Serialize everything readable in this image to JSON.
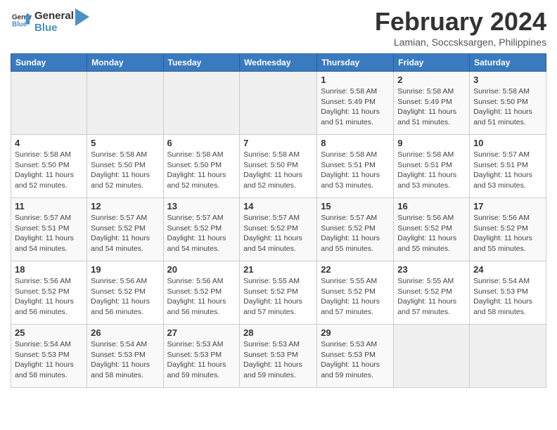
{
  "header": {
    "logo_line1": "General",
    "logo_line2": "Blue",
    "title": "February 2024",
    "subtitle": "Lamian, Soccsksargen, Philippines"
  },
  "weekdays": [
    "Sunday",
    "Monday",
    "Tuesday",
    "Wednesday",
    "Thursday",
    "Friday",
    "Saturday"
  ],
  "weeks": [
    [
      {
        "day": "",
        "info": ""
      },
      {
        "day": "",
        "info": ""
      },
      {
        "day": "",
        "info": ""
      },
      {
        "day": "",
        "info": ""
      },
      {
        "day": "1",
        "info": "Sunrise: 5:58 AM\nSunset: 5:49 PM\nDaylight: 11 hours\nand 51 minutes."
      },
      {
        "day": "2",
        "info": "Sunrise: 5:58 AM\nSunset: 5:49 PM\nDaylight: 11 hours\nand 51 minutes."
      },
      {
        "day": "3",
        "info": "Sunrise: 5:58 AM\nSunset: 5:50 PM\nDaylight: 11 hours\nand 51 minutes."
      }
    ],
    [
      {
        "day": "4",
        "info": "Sunrise: 5:58 AM\nSunset: 5:50 PM\nDaylight: 11 hours\nand 52 minutes."
      },
      {
        "day": "5",
        "info": "Sunrise: 5:58 AM\nSunset: 5:50 PM\nDaylight: 11 hours\nand 52 minutes."
      },
      {
        "day": "6",
        "info": "Sunrise: 5:58 AM\nSunset: 5:50 PM\nDaylight: 11 hours\nand 52 minutes."
      },
      {
        "day": "7",
        "info": "Sunrise: 5:58 AM\nSunset: 5:50 PM\nDaylight: 11 hours\nand 52 minutes."
      },
      {
        "day": "8",
        "info": "Sunrise: 5:58 AM\nSunset: 5:51 PM\nDaylight: 11 hours\nand 53 minutes."
      },
      {
        "day": "9",
        "info": "Sunrise: 5:58 AM\nSunset: 5:51 PM\nDaylight: 11 hours\nand 53 minutes."
      },
      {
        "day": "10",
        "info": "Sunrise: 5:57 AM\nSunset: 5:51 PM\nDaylight: 11 hours\nand 53 minutes."
      }
    ],
    [
      {
        "day": "11",
        "info": "Sunrise: 5:57 AM\nSunset: 5:51 PM\nDaylight: 11 hours\nand 54 minutes."
      },
      {
        "day": "12",
        "info": "Sunrise: 5:57 AM\nSunset: 5:52 PM\nDaylight: 11 hours\nand 54 minutes."
      },
      {
        "day": "13",
        "info": "Sunrise: 5:57 AM\nSunset: 5:52 PM\nDaylight: 11 hours\nand 54 minutes."
      },
      {
        "day": "14",
        "info": "Sunrise: 5:57 AM\nSunset: 5:52 PM\nDaylight: 11 hours\nand 54 minutes."
      },
      {
        "day": "15",
        "info": "Sunrise: 5:57 AM\nSunset: 5:52 PM\nDaylight: 11 hours\nand 55 minutes."
      },
      {
        "day": "16",
        "info": "Sunrise: 5:56 AM\nSunset: 5:52 PM\nDaylight: 11 hours\nand 55 minutes."
      },
      {
        "day": "17",
        "info": "Sunrise: 5:56 AM\nSunset: 5:52 PM\nDaylight: 11 hours\nand 55 minutes."
      }
    ],
    [
      {
        "day": "18",
        "info": "Sunrise: 5:56 AM\nSunset: 5:52 PM\nDaylight: 11 hours\nand 56 minutes."
      },
      {
        "day": "19",
        "info": "Sunrise: 5:56 AM\nSunset: 5:52 PM\nDaylight: 11 hours\nand 56 minutes."
      },
      {
        "day": "20",
        "info": "Sunrise: 5:56 AM\nSunset: 5:52 PM\nDaylight: 11 hours\nand 56 minutes."
      },
      {
        "day": "21",
        "info": "Sunrise: 5:55 AM\nSunset: 5:52 PM\nDaylight: 11 hours\nand 57 minutes."
      },
      {
        "day": "22",
        "info": "Sunrise: 5:55 AM\nSunset: 5:52 PM\nDaylight: 11 hours\nand 57 minutes."
      },
      {
        "day": "23",
        "info": "Sunrise: 5:55 AM\nSunset: 5:52 PM\nDaylight: 11 hours\nand 57 minutes."
      },
      {
        "day": "24",
        "info": "Sunrise: 5:54 AM\nSunset: 5:53 PM\nDaylight: 11 hours\nand 58 minutes."
      }
    ],
    [
      {
        "day": "25",
        "info": "Sunrise: 5:54 AM\nSunset: 5:53 PM\nDaylight: 11 hours\nand 58 minutes."
      },
      {
        "day": "26",
        "info": "Sunrise: 5:54 AM\nSunset: 5:53 PM\nDaylight: 11 hours\nand 58 minutes."
      },
      {
        "day": "27",
        "info": "Sunrise: 5:53 AM\nSunset: 5:53 PM\nDaylight: 11 hours\nand 59 minutes."
      },
      {
        "day": "28",
        "info": "Sunrise: 5:53 AM\nSunset: 5:53 PM\nDaylight: 11 hours\nand 59 minutes."
      },
      {
        "day": "29",
        "info": "Sunrise: 5:53 AM\nSunset: 5:53 PM\nDaylight: 11 hours\nand 59 minutes."
      },
      {
        "day": "",
        "info": ""
      },
      {
        "day": "",
        "info": ""
      }
    ]
  ]
}
